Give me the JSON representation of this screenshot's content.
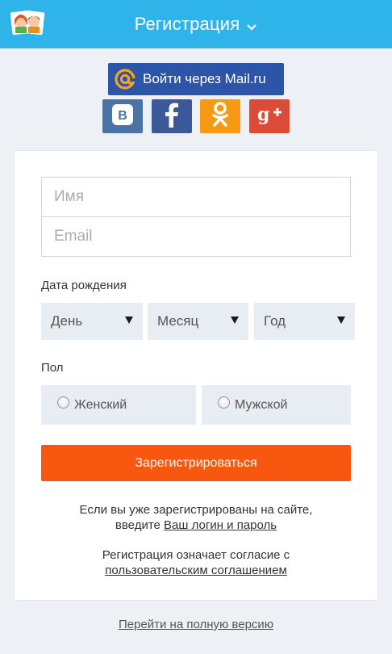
{
  "header": {
    "title": "Регистрация",
    "logo_icon": "couple-avatars-logo",
    "dropdown_icon": "chevron-down-icon",
    "color": "#2fb4ea"
  },
  "social": {
    "mailru_label": "Войти через Mail.ru",
    "mailru_icon": "at-sign-icon",
    "mailru_color": "#2c55a8",
    "buttons": [
      {
        "icon": "vk-icon",
        "glyph": "В",
        "color": "#4a74a5"
      },
      {
        "icon": "facebook-icon",
        "glyph": "f",
        "color": "#3b5998"
      },
      {
        "icon": "odnoklassniki-icon",
        "glyph": "ok",
        "color": "#f59a12"
      },
      {
        "icon": "google-plus-icon",
        "glyph": "g+",
        "color": "#dc4a38"
      }
    ]
  },
  "form": {
    "name_placeholder": "Имя",
    "email_placeholder": "Email",
    "dob_label": "Дата рождения",
    "day": "День",
    "month": "Месяц",
    "year": "Год",
    "sex_label": "Пол",
    "female": "Женский",
    "male": "Мужской",
    "submit": "Зарегистрироваться",
    "submit_color": "#f8570f"
  },
  "info": {
    "line1": "Если вы уже зарегистрированы на сайте,",
    "line2_prefix": "введите ",
    "login_link": "Ваш логин и пароль",
    "agreement_text": "Регистрация означает согласие с",
    "agreement_link": "пользовательским соглашением"
  },
  "footer": {
    "full_version": "Перейти на полную версию"
  }
}
